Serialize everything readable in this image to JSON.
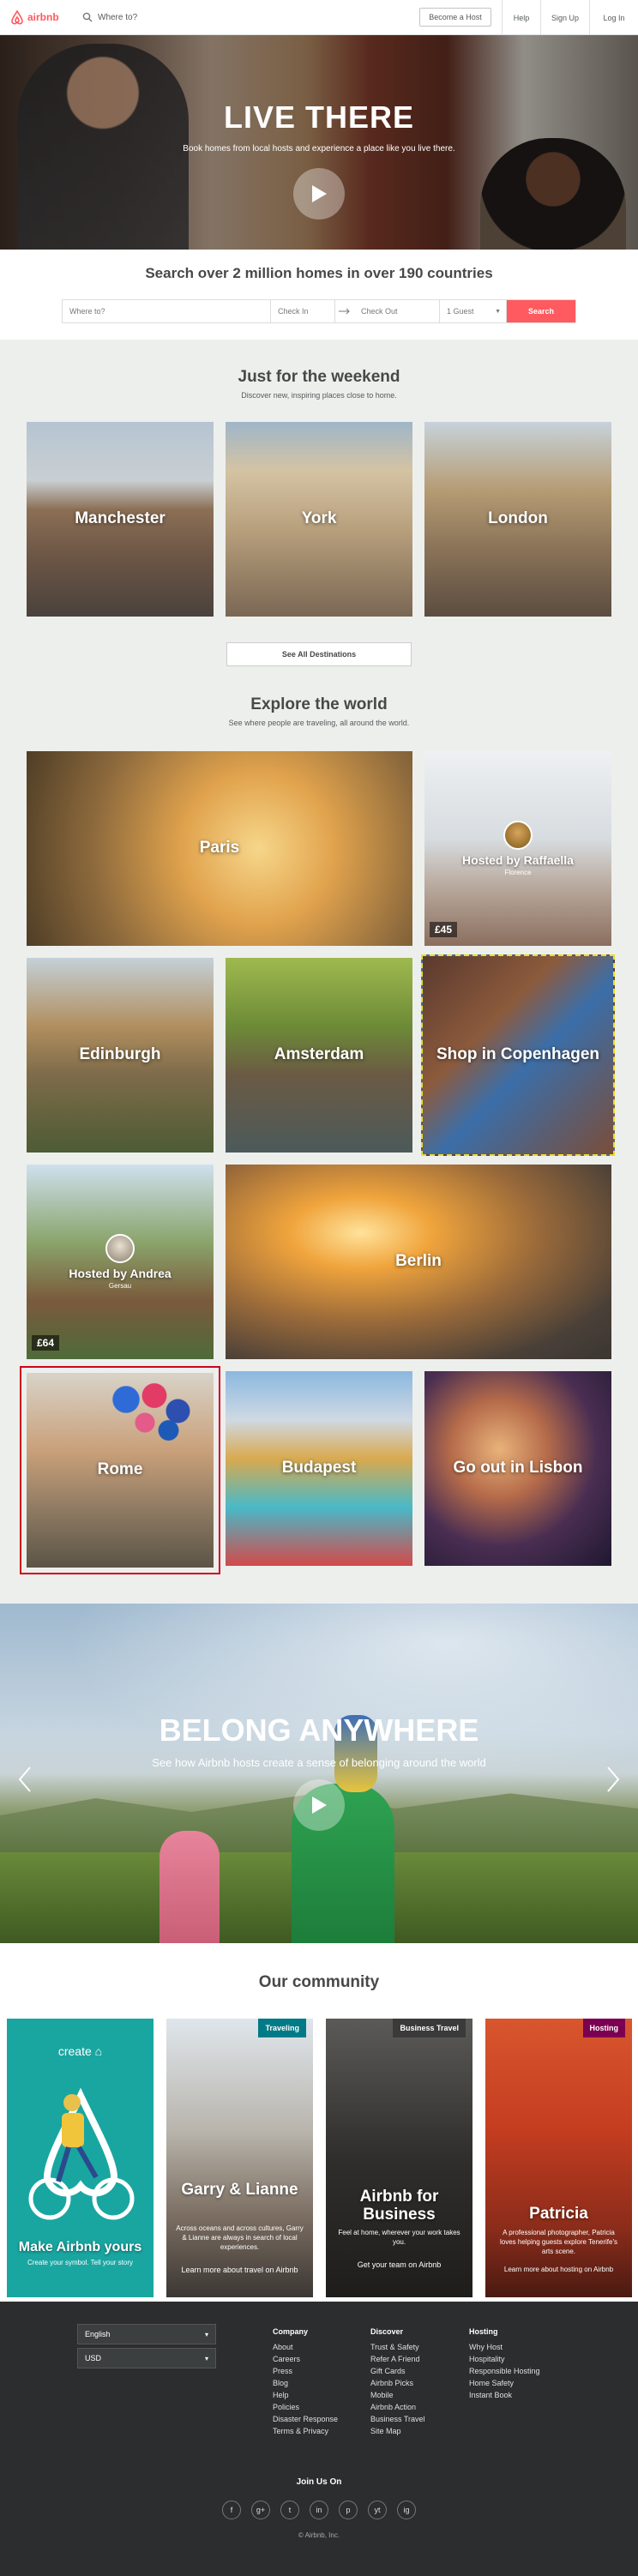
{
  "header": {
    "logo_text": "airbnb",
    "search_placeholder": "Where to?",
    "become_host": "Become a Host",
    "nav": [
      "Help",
      "Sign Up",
      "Log In"
    ]
  },
  "hero": {
    "title": "LIVE THERE",
    "subtitle": "Book homes from local hosts and experience a place like you live there."
  },
  "search": {
    "heading": "Search over 2 million homes in over 190 countries",
    "where_placeholder": "Where to?",
    "check_in": "Check In",
    "check_out": "Check Out",
    "guests": "1 Guest",
    "button": "Search"
  },
  "weekend": {
    "title": "Just for the weekend",
    "subtitle": "Discover new, inspiring places close to home.",
    "cities": [
      "Manchester",
      "York",
      "London"
    ],
    "see_all": "See All Destinations"
  },
  "explore": {
    "title": "Explore the world",
    "subtitle": "See where people are traveling, all around the world.",
    "tiles": {
      "paris": "Paris",
      "host1_name": "Hosted by Raffaella",
      "host1_loc": "Florence",
      "host1_price": "£45",
      "edinburgh": "Edinburgh",
      "amsterdam": "Amsterdam",
      "copenhagen": "Shop in Copenhagen",
      "host2_name": "Hosted by Andrea",
      "host2_loc": "Gersau",
      "host2_price": "£64",
      "berlin": "Berlin",
      "rome": "Rome",
      "budapest": "Budapest",
      "lisbon": "Go out in Lisbon"
    }
  },
  "belong": {
    "title": "BELONG ANYWHERE",
    "subtitle": "See how Airbnb hosts create a sense of belonging around the world"
  },
  "community": {
    "title": "Our community",
    "cards": [
      {
        "title": "Make Airbnb yours",
        "text": "Create your symbol. Tell your story",
        "brand": "create"
      },
      {
        "tag": "Traveling",
        "title": "Garry & Lianne",
        "text": "Across oceans and across cultures, Garry & Lianne are always in search of local experiences.",
        "cta": "Learn more about travel on Airbnb"
      },
      {
        "tag": "Business Travel",
        "title": "Airbnb for Business",
        "text": "Feel at home, wherever your work takes you.",
        "cta": "Get your team on Airbnb"
      },
      {
        "tag": "Hosting",
        "title": "Patricia",
        "text": "A professional photographer, Patricia loves helping guests explore Tenerife's arts scene.",
        "cta": "Learn more about hosting on Airbnb"
      }
    ]
  },
  "footer": {
    "language": "English",
    "currency": "USD",
    "columns": [
      {
        "heading": "Company",
        "links": [
          "About",
          "Careers",
          "Press",
          "Blog",
          "Help",
          "Policies",
          "Disaster Response",
          "Terms & Privacy"
        ]
      },
      {
        "heading": "Discover",
        "links": [
          "Trust & Safety",
          "Refer A Friend",
          "Gift Cards",
          "Airbnb Picks",
          "Mobile",
          "Airbnb Action",
          "Business Travel",
          "Site Map"
        ]
      },
      {
        "heading": "Hosting",
        "links": [
          "Why Host",
          "Hospitality",
          "Responsible Hosting",
          "Home Safety",
          "Instant Book"
        ]
      }
    ],
    "join_us": "Join Us On",
    "social": [
      "f",
      "g+",
      "t",
      "in",
      "p",
      "yt",
      "ig"
    ],
    "copyright": "© Airbnb, Inc."
  },
  "colors": {
    "brand": "#ff5a5f",
    "footer_bg": "#2b2d2e",
    "section_bg": "#edefed"
  }
}
